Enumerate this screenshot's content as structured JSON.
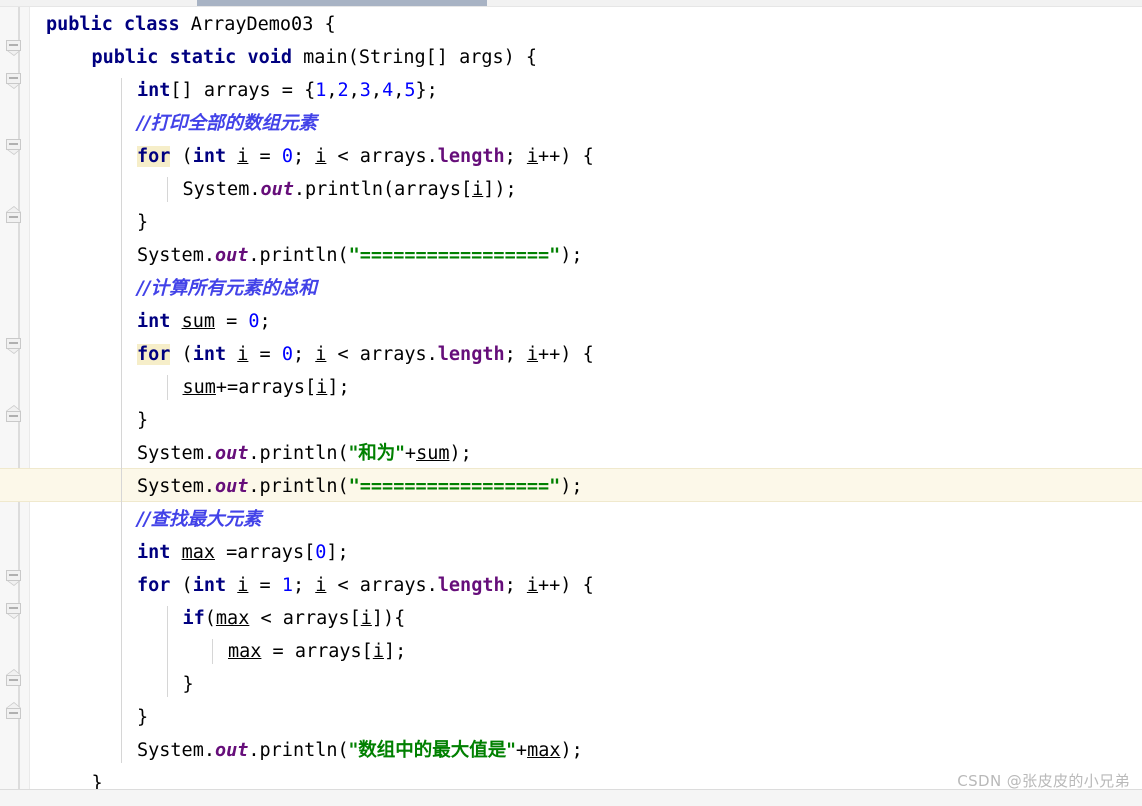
{
  "app": {
    "type": "code-editor",
    "language": "Java",
    "class_name": "ArrayDemo03"
  },
  "topbar": {
    "scrollbar_thumb_label": "horizontal-scrollbar-thumb"
  },
  "gutter": {
    "fold_markers": [
      {
        "label": "fold-collapse-class",
        "direction": "down"
      },
      {
        "label": "fold-collapse-method",
        "direction": "down"
      },
      {
        "label": "fold-collapse-for-1",
        "direction": "down"
      },
      {
        "label": "fold-end-for-1",
        "direction": "up"
      },
      {
        "label": "fold-collapse-for-2",
        "direction": "down"
      },
      {
        "label": "fold-end-for-2",
        "direction": "up"
      },
      {
        "label": "fold-collapse-for-3",
        "direction": "down"
      },
      {
        "label": "fold-collapse-if",
        "direction": "down"
      },
      {
        "label": "fold-end-if",
        "direction": "up"
      },
      {
        "label": "fold-end-for-3",
        "direction": "up"
      }
    ]
  },
  "editor": {
    "current_line_index": 14,
    "colors": {
      "keyword": "#000080",
      "string": "#008000",
      "number": "#0000ff",
      "comment": "#4242e8",
      "field": "#660e7a",
      "keyword_highlight_bg": "#f6eec9",
      "current_line_bg": "#fcf8e9",
      "background": "#ffffff",
      "gutter_bg": "#f7f7f7"
    },
    "lines": [
      {
        "indent": 0,
        "tokens": [
          {
            "t": "public",
            "c": "kw"
          },
          {
            "t": " ",
            "c": "pl"
          },
          {
            "t": "class",
            "c": "kw"
          },
          {
            "t": " ArrayDemo03 {",
            "c": "pl"
          }
        ]
      },
      {
        "indent": 1,
        "tokens": [
          {
            "t": "public",
            "c": "kw"
          },
          {
            "t": " ",
            "c": "pl"
          },
          {
            "t": "static",
            "c": "kw"
          },
          {
            "t": " ",
            "c": "pl"
          },
          {
            "t": "void",
            "c": "kw"
          },
          {
            "t": " main(String[] args) {",
            "c": "pl"
          }
        ]
      },
      {
        "indent": 2,
        "tokens": [
          {
            "t": "int",
            "c": "kw"
          },
          {
            "t": "[] arrays = {",
            "c": "pl"
          },
          {
            "t": "1",
            "c": "num"
          },
          {
            "t": ",",
            "c": "pl"
          },
          {
            "t": "2",
            "c": "num"
          },
          {
            "t": ",",
            "c": "pl"
          },
          {
            "t": "3",
            "c": "num"
          },
          {
            "t": ",",
            "c": "pl"
          },
          {
            "t": "4",
            "c": "num"
          },
          {
            "t": ",",
            "c": "pl"
          },
          {
            "t": "5",
            "c": "num"
          },
          {
            "t": "};",
            "c": "pl"
          }
        ]
      },
      {
        "indent": 2,
        "tokens": [
          {
            "t": "//打印全部的数组元素",
            "c": "cmt"
          }
        ]
      },
      {
        "indent": 2,
        "tokens": [
          {
            "t": "for",
            "c": "kwhl"
          },
          {
            "t": " (",
            "c": "pl"
          },
          {
            "t": "int",
            "c": "kw"
          },
          {
            "t": " ",
            "c": "pl"
          },
          {
            "t": "i",
            "c": "var"
          },
          {
            "t": " = ",
            "c": "pl"
          },
          {
            "t": "0",
            "c": "num"
          },
          {
            "t": "; ",
            "c": "pl"
          },
          {
            "t": "i",
            "c": "var"
          },
          {
            "t": " < arrays.",
            "c": "pl"
          },
          {
            "t": "length",
            "c": "fld"
          },
          {
            "t": "; ",
            "c": "pl"
          },
          {
            "t": "i",
            "c": "var"
          },
          {
            "t": "++) {",
            "c": "pl"
          }
        ]
      },
      {
        "indent": 3,
        "tokens": [
          {
            "t": "System.",
            "c": "pl"
          },
          {
            "t": "out",
            "c": "fldi"
          },
          {
            "t": ".println(arrays[",
            "c": "pl"
          },
          {
            "t": "i",
            "c": "var"
          },
          {
            "t": "]);",
            "c": "pl"
          }
        ]
      },
      {
        "indent": 2,
        "tokens": [
          {
            "t": "}",
            "c": "pl"
          }
        ]
      },
      {
        "indent": 2,
        "tokens": [
          {
            "t": "System.",
            "c": "pl"
          },
          {
            "t": "out",
            "c": "fldi"
          },
          {
            "t": ".println(",
            "c": "pl"
          },
          {
            "t": "\"=================\"",
            "c": "str"
          },
          {
            "t": ");",
            "c": "pl"
          }
        ]
      },
      {
        "indent": 2,
        "tokens": [
          {
            "t": "//计算所有元素的总和",
            "c": "cmt"
          }
        ]
      },
      {
        "indent": 2,
        "tokens": [
          {
            "t": "int",
            "c": "kw"
          },
          {
            "t": " ",
            "c": "pl"
          },
          {
            "t": "sum",
            "c": "var"
          },
          {
            "t": " = ",
            "c": "pl"
          },
          {
            "t": "0",
            "c": "num"
          },
          {
            "t": ";",
            "c": "pl"
          }
        ]
      },
      {
        "indent": 2,
        "tokens": [
          {
            "t": "for",
            "c": "kwhl"
          },
          {
            "t": " (",
            "c": "pl"
          },
          {
            "t": "int",
            "c": "kw"
          },
          {
            "t": " ",
            "c": "pl"
          },
          {
            "t": "i",
            "c": "var"
          },
          {
            "t": " = ",
            "c": "pl"
          },
          {
            "t": "0",
            "c": "num"
          },
          {
            "t": "; ",
            "c": "pl"
          },
          {
            "t": "i",
            "c": "var"
          },
          {
            "t": " < arrays.",
            "c": "pl"
          },
          {
            "t": "length",
            "c": "fld"
          },
          {
            "t": "; ",
            "c": "pl"
          },
          {
            "t": "i",
            "c": "var"
          },
          {
            "t": "++) {",
            "c": "pl"
          }
        ]
      },
      {
        "indent": 3,
        "tokens": [
          {
            "t": "sum",
            "c": "var"
          },
          {
            "t": "+=arrays[",
            "c": "pl"
          },
          {
            "t": "i",
            "c": "var"
          },
          {
            "t": "];",
            "c": "pl"
          }
        ]
      },
      {
        "indent": 2,
        "tokens": [
          {
            "t": "}",
            "c": "pl"
          }
        ]
      },
      {
        "indent": 2,
        "tokens": [
          {
            "t": "System.",
            "c": "pl"
          },
          {
            "t": "out",
            "c": "fldi"
          },
          {
            "t": ".println(",
            "c": "pl"
          },
          {
            "t": "\"和为\"",
            "c": "str"
          },
          {
            "t": "+",
            "c": "pl"
          },
          {
            "t": "sum",
            "c": "var"
          },
          {
            "t": ");",
            "c": "pl"
          }
        ]
      },
      {
        "indent": 2,
        "tokens": [
          {
            "t": "System.",
            "c": "pl"
          },
          {
            "t": "out",
            "c": "fldi"
          },
          {
            "t": ".println(",
            "c": "pl"
          },
          {
            "t": "\"=================\"",
            "c": "str"
          },
          {
            "t": ");",
            "c": "pl"
          }
        ]
      },
      {
        "indent": 2,
        "tokens": [
          {
            "t": "//查找最大元素",
            "c": "cmt"
          }
        ]
      },
      {
        "indent": 2,
        "tokens": [
          {
            "t": "int",
            "c": "kw"
          },
          {
            "t": " ",
            "c": "pl"
          },
          {
            "t": "max",
            "c": "var"
          },
          {
            "t": " =arrays[",
            "c": "pl"
          },
          {
            "t": "0",
            "c": "num"
          },
          {
            "t": "];",
            "c": "pl"
          }
        ]
      },
      {
        "indent": 2,
        "tokens": [
          {
            "t": "for",
            "c": "kw"
          },
          {
            "t": " (",
            "c": "pl"
          },
          {
            "t": "int",
            "c": "kw"
          },
          {
            "t": " ",
            "c": "pl"
          },
          {
            "t": "i",
            "c": "var"
          },
          {
            "t": " = ",
            "c": "pl"
          },
          {
            "t": "1",
            "c": "num"
          },
          {
            "t": "; ",
            "c": "pl"
          },
          {
            "t": "i",
            "c": "var"
          },
          {
            "t": " < arrays.",
            "c": "pl"
          },
          {
            "t": "length",
            "c": "fld"
          },
          {
            "t": "; ",
            "c": "pl"
          },
          {
            "t": "i",
            "c": "var"
          },
          {
            "t": "++) {",
            "c": "pl"
          }
        ]
      },
      {
        "indent": 3,
        "tokens": [
          {
            "t": "if",
            "c": "kw"
          },
          {
            "t": "(",
            "c": "pl"
          },
          {
            "t": "max",
            "c": "var"
          },
          {
            "t": " < arrays[",
            "c": "pl"
          },
          {
            "t": "i",
            "c": "var"
          },
          {
            "t": "]){",
            "c": "pl"
          }
        ]
      },
      {
        "indent": 4,
        "tokens": [
          {
            "t": "max",
            "c": "var"
          },
          {
            "t": " = arrays[",
            "c": "pl"
          },
          {
            "t": "i",
            "c": "var"
          },
          {
            "t": "];",
            "c": "pl"
          }
        ]
      },
      {
        "indent": 3,
        "tokens": [
          {
            "t": "}",
            "c": "pl"
          }
        ]
      },
      {
        "indent": 2,
        "tokens": [
          {
            "t": "}",
            "c": "pl"
          }
        ]
      },
      {
        "indent": 2,
        "tokens": [
          {
            "t": "System.",
            "c": "pl"
          },
          {
            "t": "out",
            "c": "fldi"
          },
          {
            "t": ".println(",
            "c": "pl"
          },
          {
            "t": "\"数组中的最大值是\"",
            "c": "str"
          },
          {
            "t": "+",
            "c": "pl"
          },
          {
            "t": "max",
            "c": "var"
          },
          {
            "t": ");",
            "c": "pl"
          }
        ]
      },
      {
        "indent": 1,
        "tokens": [
          {
            "t": "}",
            "c": "pl"
          }
        ]
      }
    ]
  },
  "watermark": {
    "text": "CSDN @张皮皮的小兄弟"
  }
}
